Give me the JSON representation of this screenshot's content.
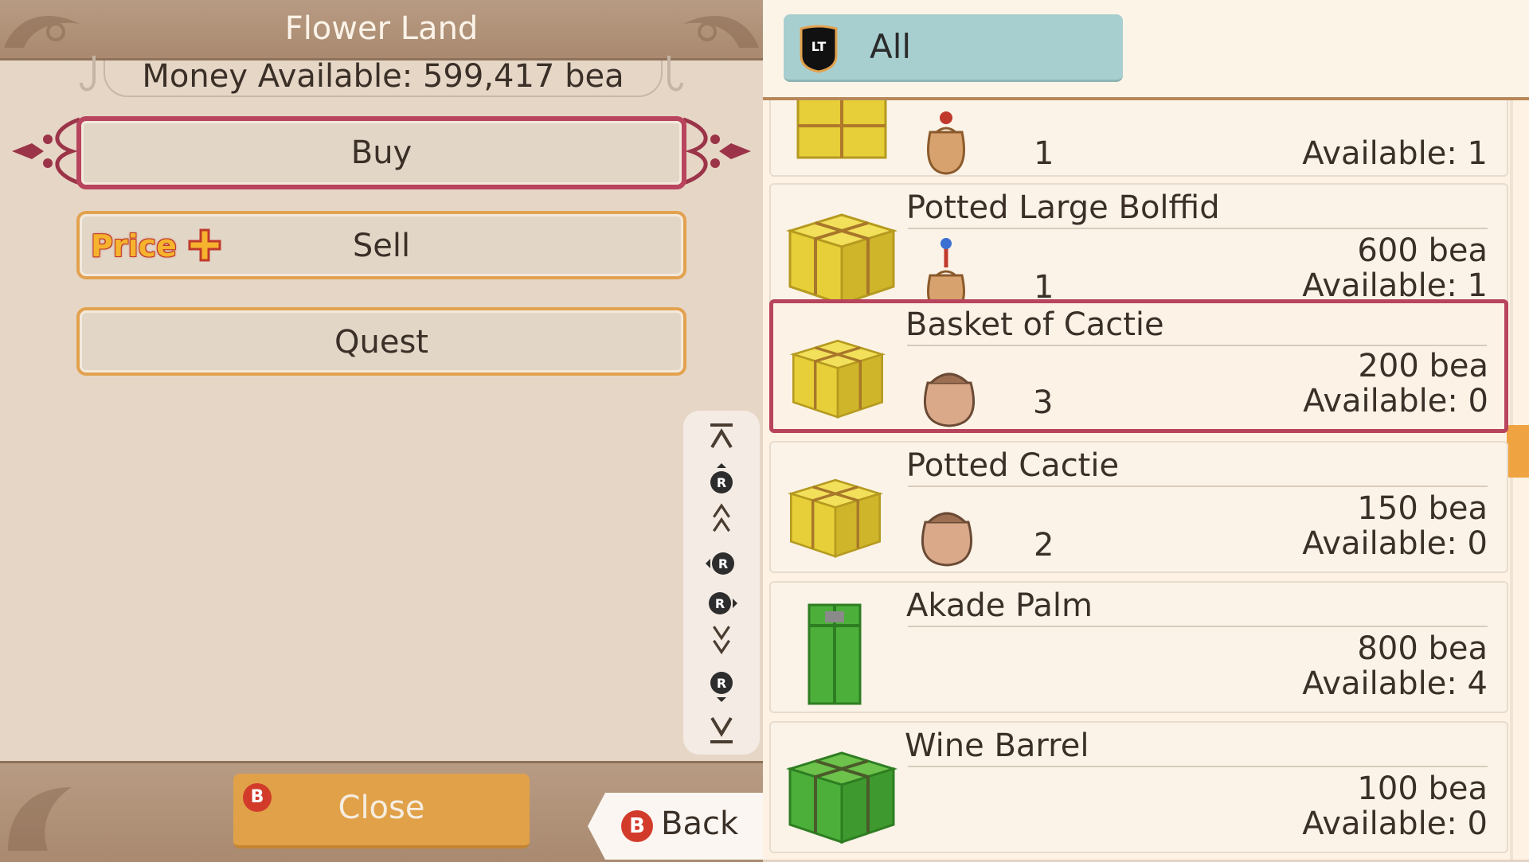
{
  "shop": {
    "title": "Flower Land",
    "money_label": "Money Available: 599,417 bea"
  },
  "menu": {
    "buy_label": "Buy",
    "sell_label": "Sell",
    "quest_label": "Quest",
    "price_badge": "Price"
  },
  "footer": {
    "close_label": "Close",
    "close_key": "B",
    "back_label": "Back",
    "back_key": "B"
  },
  "filter": {
    "key": "LT",
    "label": "All"
  },
  "items": [
    {
      "name": "",
      "price": "",
      "qty": "1",
      "available": "Available: 1",
      "gift": "yellow",
      "bag": "red"
    },
    {
      "name": "Potted Large Bolffid",
      "price": "600 bea",
      "qty": "1",
      "available": "Available: 1",
      "gift": "yellow",
      "bag": "red"
    },
    {
      "name": "Basket of Cactie",
      "price": "200 bea",
      "qty": "3",
      "available": "Available: 0",
      "gift": "yellow",
      "bag": "plain"
    },
    {
      "name": "Potted Cactie",
      "price": "150 bea",
      "qty": "2",
      "available": "Available: 0",
      "gift": "yellow",
      "bag": "plain"
    },
    {
      "name": "Akade Palm",
      "price": "800 bea",
      "qty": "",
      "available": "Available: 4",
      "gift": "green-tall",
      "bag": ""
    },
    {
      "name": "Wine Barrel",
      "price": "100 bea",
      "qty": "",
      "available": "Available: 0",
      "gift": "green",
      "bag": ""
    }
  ],
  "selected_item": "Basket of Cactie",
  "colors": {
    "accent_selected": "#b8445d",
    "accent_orange": "#e2a24f",
    "filter_pill": "#a8cfd0"
  },
  "icons": [
    "lt-trigger-icon",
    "scroll-top-icon",
    "r-stick-up-icon",
    "page-up-icon",
    "r-stick-left-icon",
    "r-stick-right-icon",
    "page-down-icon",
    "r-stick-down-icon",
    "scroll-bottom-icon",
    "gift-box-icon",
    "seed-bag-icon",
    "plus-icon"
  ]
}
